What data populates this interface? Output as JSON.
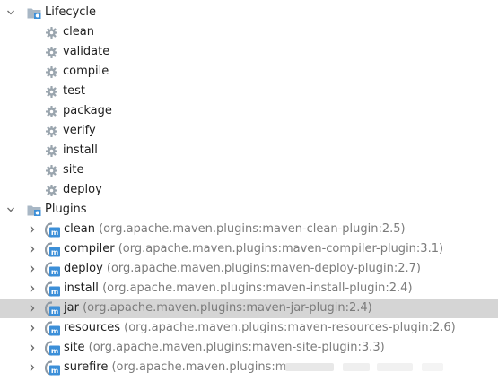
{
  "tree": {
    "lifecycle": {
      "label": "Lifecycle",
      "expanded": true,
      "phases": [
        "clean",
        "validate",
        "compile",
        "test",
        "package",
        "verify",
        "install",
        "site",
        "deploy"
      ]
    },
    "plugins": {
      "label": "Plugins",
      "expanded": true,
      "items": [
        {
          "name": "clean",
          "detail": "(org.apache.maven.plugins:maven-clean-plugin:2.5)"
        },
        {
          "name": "compiler",
          "detail": "(org.apache.maven.plugins:maven-compiler-plugin:3.1)"
        },
        {
          "name": "deploy",
          "detail": "(org.apache.maven.plugins:maven-deploy-plugin:2.7)"
        },
        {
          "name": "install",
          "detail": "(org.apache.maven.plugins:maven-install-plugin:2.4)"
        },
        {
          "name": "jar",
          "detail": "(org.apache.maven.plugins:maven-jar-plugin:2.4)",
          "selected": true
        },
        {
          "name": "resources",
          "detail": "(org.apache.maven.plugins:maven-resources-plugin:2.6)"
        },
        {
          "name": "site",
          "detail": "(org.apache.maven.plugins:maven-site-plugin:3.3)"
        },
        {
          "name": "surefire",
          "detail": "(org.apache.maven.plugins:m"
        }
      ]
    }
  },
  "colors": {
    "selection": "#d5d5d5",
    "text": "#1e1e1e",
    "secondary_text": "#7b7b7b",
    "gear": "#9aa5ae",
    "folder": "#a8b7c5",
    "folder_badge": "#3c8fd8"
  },
  "icons": {
    "expanded": "chevron-down-icon",
    "collapsed": "chevron-right-icon",
    "group": "folder-icon",
    "phase": "gear-icon",
    "plugin": "maven-plugin-icon"
  }
}
